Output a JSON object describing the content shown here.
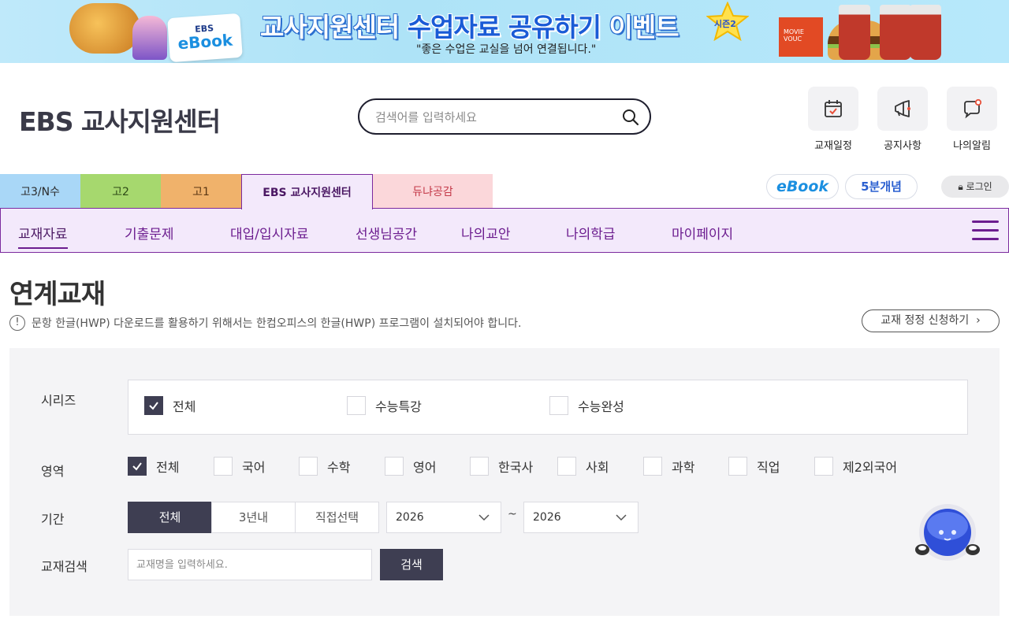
{
  "banner": {
    "ebook_small": "EBS",
    "ebook_big": "eBook",
    "headline_pre": "교사지원센터",
    "headline_mid": "수업자료 공유하기",
    "headline_post": "이벤트",
    "season": "시즌2",
    "tagline": "\"좋은 수업은 교실을 넘어 연결됩니다.\"",
    "movie": "MOVIE VOUC"
  },
  "header": {
    "logo": "EBS 교사지원센터",
    "search_placeholder": "검색어를 입력하세요",
    "quick": [
      {
        "label": "교재일정",
        "icon": "calendar-check-icon"
      },
      {
        "label": "공지사항",
        "icon": "megaphone-icon"
      },
      {
        "label": "나의알림",
        "icon": "chat-bell-icon"
      }
    ]
  },
  "tabs": {
    "g3": "고3/N수",
    "g2": "고2",
    "g1": "고1",
    "teacher": "EBS 교사지원센터",
    "dyuna": "듀냐공감"
  },
  "utility": {
    "ebook": "eBook",
    "five_min": "5분개념",
    "login": "로그인"
  },
  "nav": {
    "items": [
      "교재자료",
      "기출문제",
      "대입/입시자료",
      "선생님공간",
      "나의교안",
      "나의학급",
      "마이페이지"
    ],
    "active_index": 0
  },
  "content": {
    "title": "연계교재",
    "notice": "문항 한글(HWP) 다운로드를 활용하기 위해서는 한컴오피스의 한글(HWP) 프로그램이 설치되어야 합니다.",
    "correction_button": "교재 정정 신청하기"
  },
  "filter": {
    "series_label": "시리즈",
    "series_options": [
      {
        "label": "전체",
        "checked": true
      },
      {
        "label": "수능특강",
        "checked": false
      },
      {
        "label": "수능완성",
        "checked": false
      }
    ],
    "area_label": "영역",
    "area_options": [
      {
        "label": "전체",
        "checked": true
      },
      {
        "label": "국어",
        "checked": false
      },
      {
        "label": "수학",
        "checked": false
      },
      {
        "label": "영어",
        "checked": false
      },
      {
        "label": "한국사",
        "checked": false
      },
      {
        "label": "사회",
        "checked": false
      },
      {
        "label": "과학",
        "checked": false
      },
      {
        "label": "직업",
        "checked": false
      },
      {
        "label": "제2외국어",
        "checked": false
      }
    ],
    "period_label": "기간",
    "period_options": [
      "전체",
      "3년내",
      "직접선택"
    ],
    "period_selected": "전체",
    "year_from": "2026",
    "year_separator": "~",
    "year_to": "2026",
    "search_label": "교재검색",
    "search_placeholder": "교재명을 입력하세요.",
    "search_button": "검색"
  },
  "colors": {
    "nav_purple": "#6c1d8f",
    "nav_bg": "#f3e9fb",
    "dark_button": "#3e3e52"
  }
}
